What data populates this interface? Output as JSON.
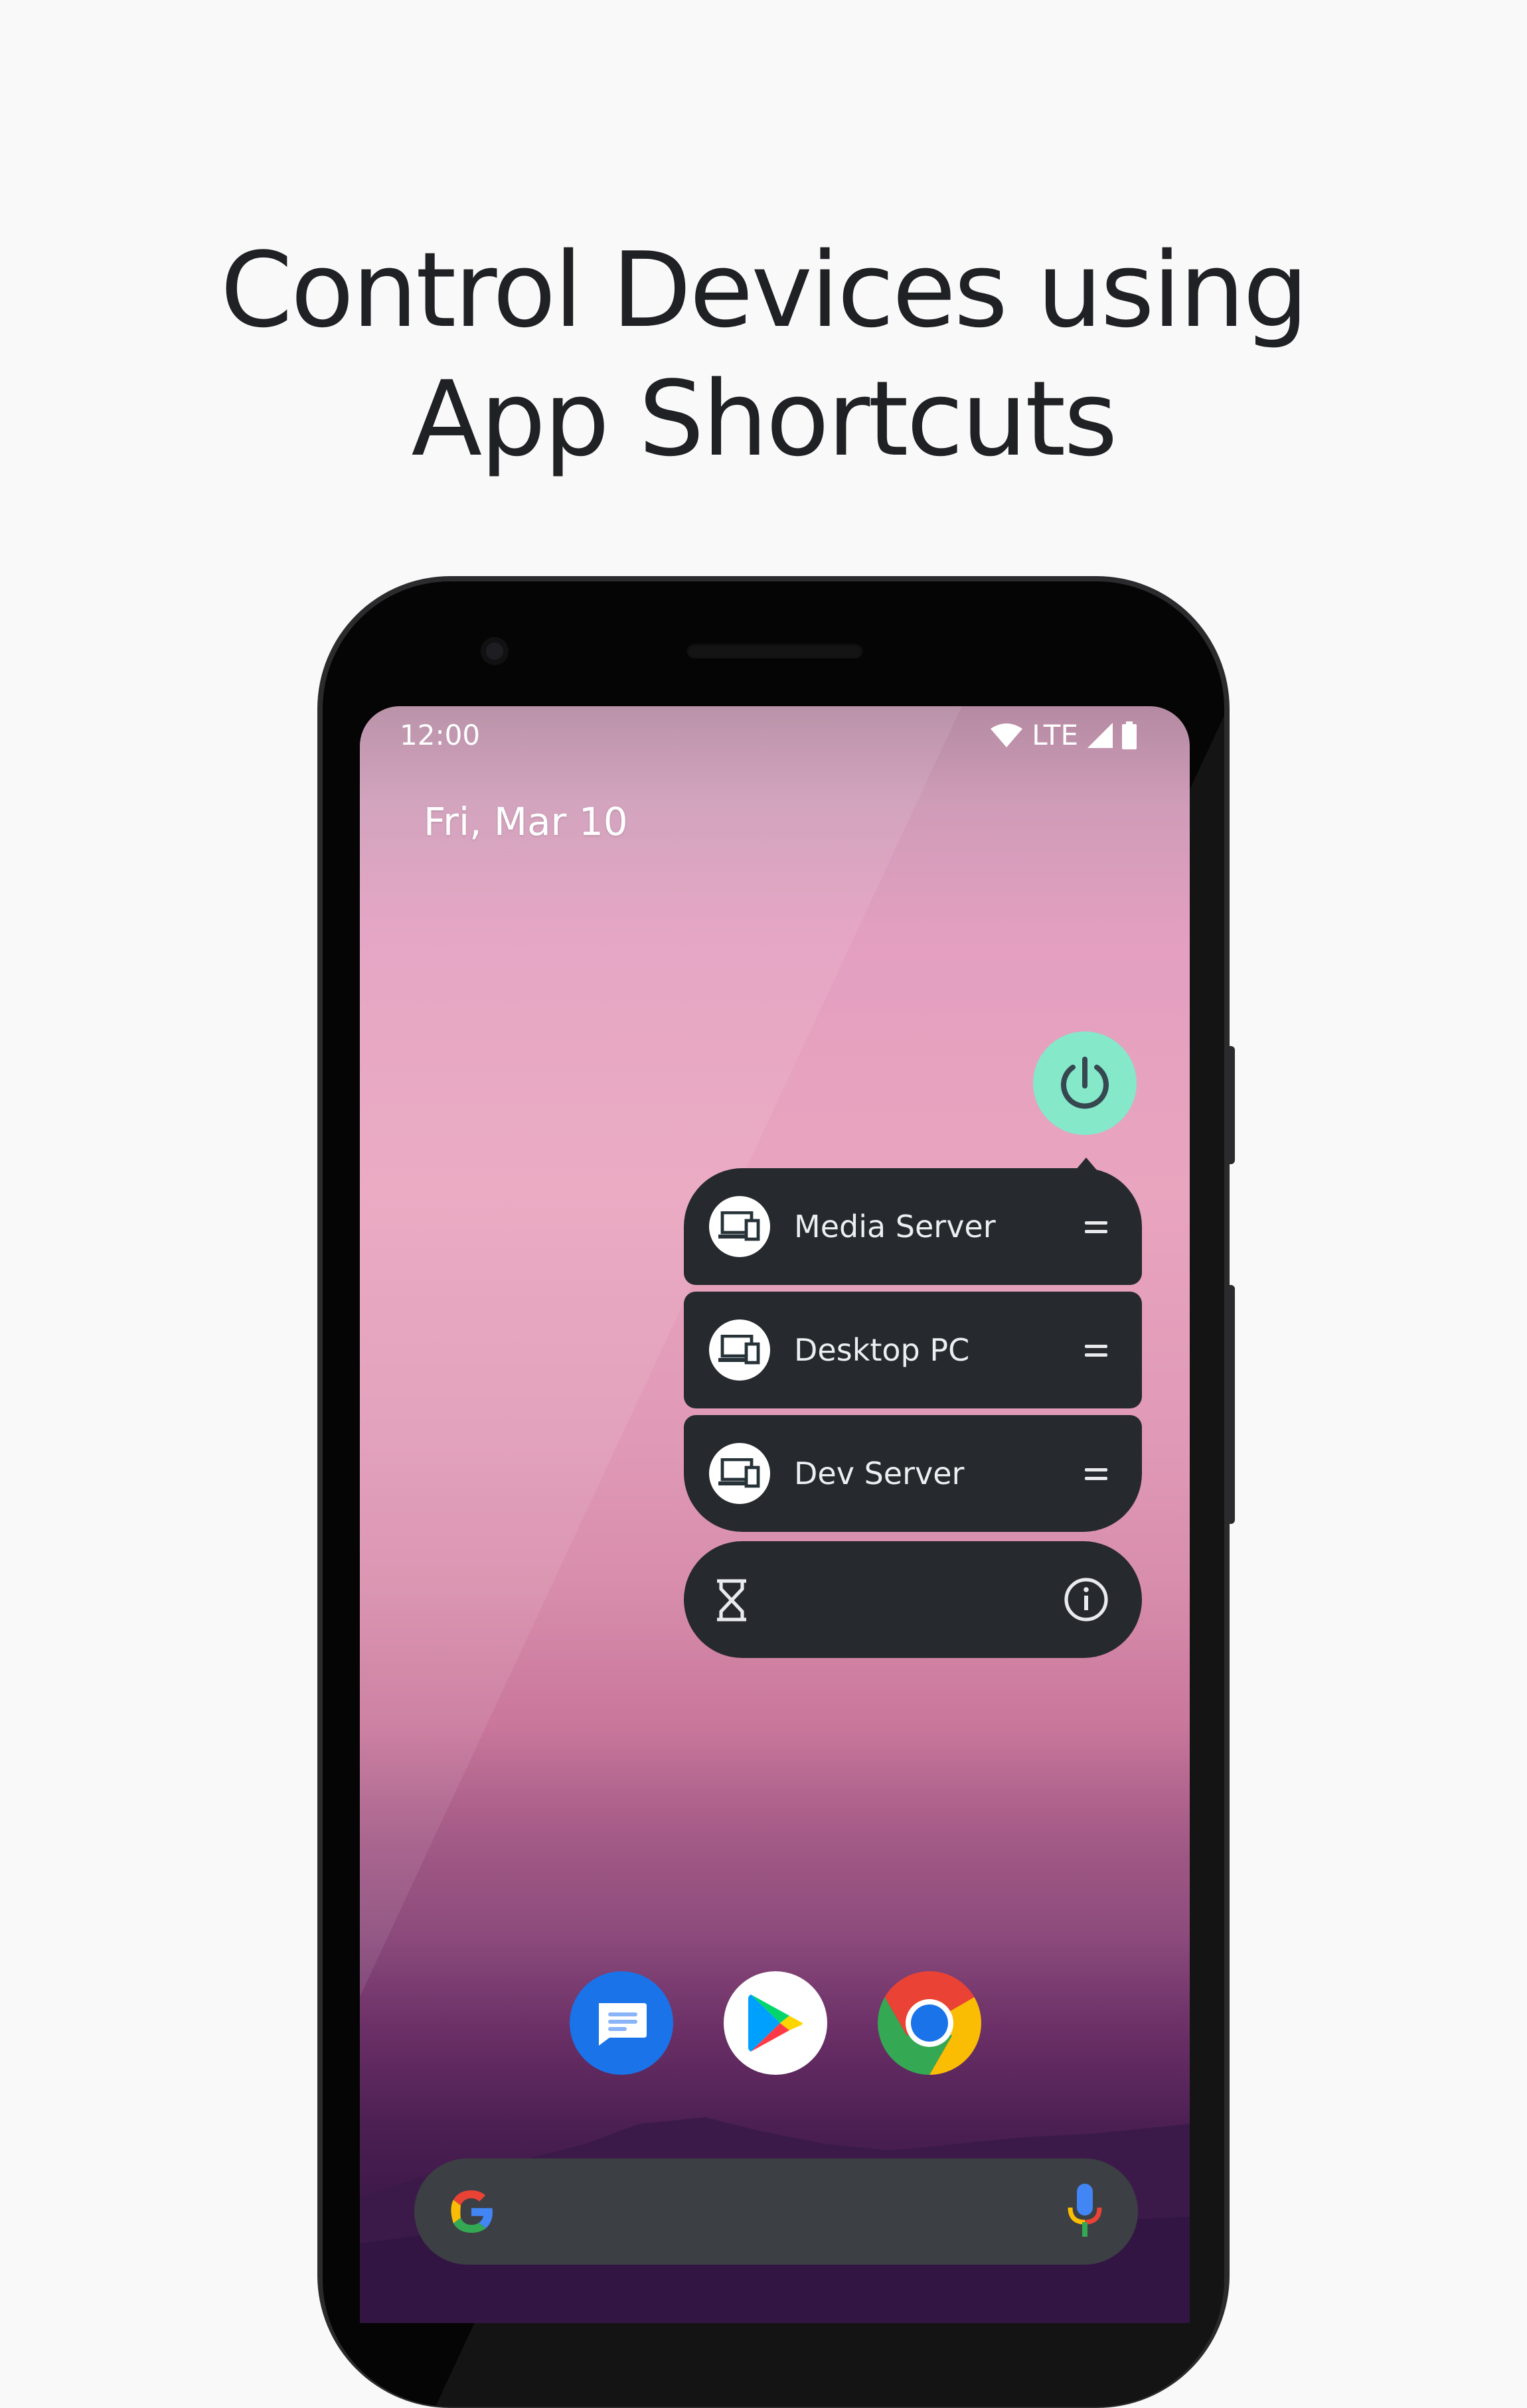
{
  "headline": {
    "line1": "Control Devices using",
    "line2": "App Shortcuts"
  },
  "status_bar": {
    "time": "12:00",
    "network": "LTE",
    "icons": [
      "wifi-icon",
      "cell-signal-icon",
      "battery-icon"
    ]
  },
  "home": {
    "date": "Fri, Mar 10"
  },
  "app": {
    "icon": "power-icon",
    "accent_color": "#84e8c9"
  },
  "shortcuts": [
    {
      "label": "Media Server",
      "icon": "devices-icon"
    },
    {
      "label": "Desktop PC",
      "icon": "devices-icon"
    },
    {
      "label": "Dev Server",
      "icon": "devices-icon"
    }
  ],
  "popup_footer": {
    "icons": [
      "hourglass-icon",
      "info-icon"
    ]
  },
  "dock": {
    "apps": [
      "messages-icon",
      "play-store-icon",
      "chrome-icon"
    ]
  },
  "search_bar": {
    "icons": [
      "google-g-icon",
      "mic-icon"
    ]
  },
  "colors": {
    "popup_bg": "#262a2e",
    "search_bg": "#3c3f43"
  }
}
